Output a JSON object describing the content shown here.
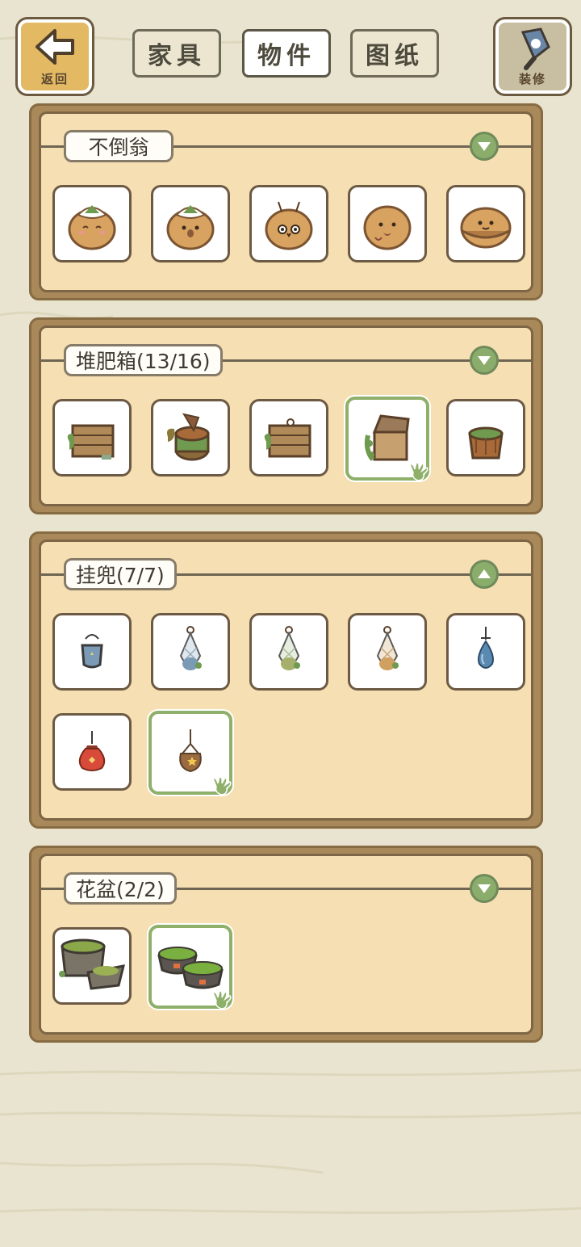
{
  "topbar": {
    "back_label": "返回",
    "decorate_label": "装修",
    "tabs": [
      {
        "label": "家具",
        "active": false
      },
      {
        "label": "物件",
        "active": true
      },
      {
        "label": "图纸",
        "active": false
      }
    ]
  },
  "categories": [
    {
      "label": "不倒翁",
      "expanded": false,
      "items": [
        "tumbler-leaf-smile",
        "tumbler-leaf-bird",
        "tumbler-antenna",
        "tumbler-heart",
        "tumbler-hat"
      ],
      "selected_index": null
    },
    {
      "label": "堆肥箱(13/16)",
      "expanded": false,
      "items": [
        "compost-crate",
        "compost-log",
        "compost-crate-2",
        "compost-open-chest",
        "compost-stump"
      ],
      "selected_index": 3
    },
    {
      "label": "挂兜(7/7)",
      "expanded": true,
      "items": [
        "hanging-blue-bag",
        "hanging-blue-net",
        "hanging-green-net",
        "hanging-orange-net",
        "hanging-water-drop",
        "hanging-red-lucky-bag",
        "hanging-star-pouch"
      ],
      "selected_index": 6
    },
    {
      "label": "花盆(2/2)",
      "expanded": false,
      "items": [
        "moss-stone-pot",
        "moss-bowl-pair"
      ],
      "selected_index": 1
    }
  ],
  "colors": {
    "background": "#e9e4cf",
    "panel_frame": "#a9895a",
    "panel_fill": "#f6dfb2",
    "selected_border": "#8fb06a",
    "toggle": "#8bad6c"
  }
}
